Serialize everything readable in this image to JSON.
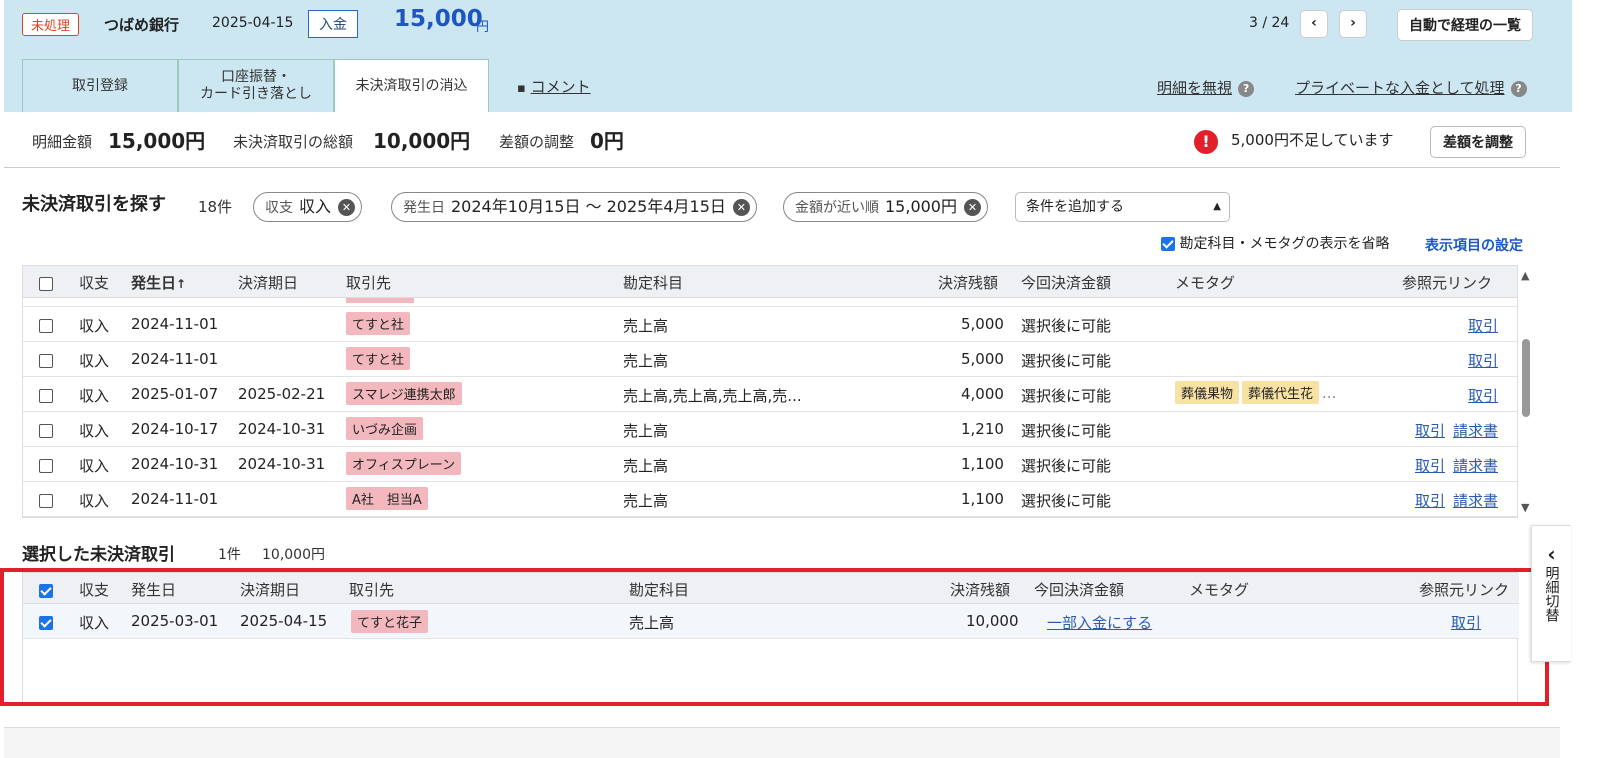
{
  "header": {
    "status": "未処理",
    "bank": "つばめ銀行",
    "date": "2025-04-15",
    "kind": "入金",
    "amount": "15,000",
    "yen": "円",
    "pager": "3 / 24",
    "prev": "‹",
    "next": "›",
    "auto_button": "自動で経理の一覧"
  },
  "tabs": [
    {
      "label": "取引登録"
    },
    {
      "label1": "口座振替・",
      "label2": "カード引き落とし"
    },
    {
      "label": "未決済取引の消込"
    }
  ],
  "comment": "コメント",
  "links": {
    "ignore": "明細を無視",
    "private": "プライベートな入金として処理"
  },
  "summary": {
    "detail_label": "明細金額",
    "detail_value": "15,000円",
    "unsettled_label": "未決済取引の総額",
    "unsettled_value": "10,000円",
    "diff_label": "差額の調整",
    "diff_value": "0円",
    "warning": "5,000円不足しています",
    "adjust_button": "差額を調整"
  },
  "search": {
    "title": "未決済取引を探す",
    "count": "18件",
    "chips": [
      {
        "label": "収支",
        "value": "収入"
      },
      {
        "label": "発生日",
        "value": "2024年10月15日 〜 2025年4月15日"
      },
      {
        "label": "金額が近い順",
        "value": "15,000円"
      }
    ],
    "add_condition": "条件を追加する",
    "omit_label": "勘定科目・メモタグの表示を省略",
    "settings": "表示項目の設定"
  },
  "columns": {
    "type": "収支",
    "date": "発生日",
    "due": "決済期日",
    "partner": "取引先",
    "account": "勘定科目",
    "balance": "決済残額",
    "this_amount": "今回決済金額",
    "memo": "メモタグ",
    "ref": "参照元リンク"
  },
  "sort_arrow": "↑",
  "rows": [
    {
      "type": "収入",
      "date": "2024-11-01",
      "due": "",
      "partner": "てすと社",
      "account": "売上高",
      "balance": "5,000",
      "this_amount": "選択後に可能",
      "memo1": "",
      "memo2": "",
      "link1": "取引",
      "link2": ""
    },
    {
      "type": "収入",
      "date": "2024-11-01",
      "due": "",
      "partner": "てすと社",
      "account": "売上高",
      "balance": "5,000",
      "this_amount": "選択後に可能",
      "memo1": "",
      "memo2": "",
      "link1": "取引",
      "link2": ""
    },
    {
      "type": "収入",
      "date": "2025-01-07",
      "due": "2025-02-21",
      "partner": "スマレジ連携太郎",
      "account": "売上高,売上高,売上高,売...",
      "balance": "4,000",
      "this_amount": "選択後に可能",
      "memo1": "葬儀果物",
      "memo2": "葬儀代生花",
      "link1": "取引",
      "link2": ""
    },
    {
      "type": "収入",
      "date": "2024-10-17",
      "due": "2024-10-31",
      "partner": "いづみ企画",
      "account": "売上高",
      "balance": "1,210",
      "this_amount": "選択後に可能",
      "memo1": "",
      "memo2": "",
      "link1": "取引",
      "link2": "請求書"
    },
    {
      "type": "収入",
      "date": "2024-10-31",
      "due": "2024-10-31",
      "partner": "オフィスプレーン",
      "account": "売上高",
      "balance": "1,100",
      "this_amount": "選択後に可能",
      "memo1": "",
      "memo2": "",
      "link1": "取引",
      "link2": "請求書"
    },
    {
      "type": "収入",
      "date": "2024-11-01",
      "due": "",
      "partner": "A社　担当A",
      "account": "売上高",
      "balance": "1,100",
      "this_amount": "選択後に可能",
      "memo1": "",
      "memo2": "",
      "link1": "取引",
      "link2": "請求書"
    }
  ],
  "selected": {
    "title": "選択した未決済取引",
    "count": "1件",
    "total": "10,000円",
    "row": {
      "type": "収入",
      "date": "2025-03-01",
      "due": "2025-04-15",
      "partner": "てすと花子",
      "account": "売上高",
      "balance": "10,000",
      "this_amount": "一部入金にする",
      "link": "取引"
    }
  },
  "side_tab": {
    "arrow": "‹",
    "text": "明細切替"
  },
  "colors": {
    "header_bg": "#cce6f2",
    "accent": "#1f55c0",
    "highlight": "#e0202a",
    "tag": "#f2b8bd",
    "memo": "#f7e2a4"
  }
}
